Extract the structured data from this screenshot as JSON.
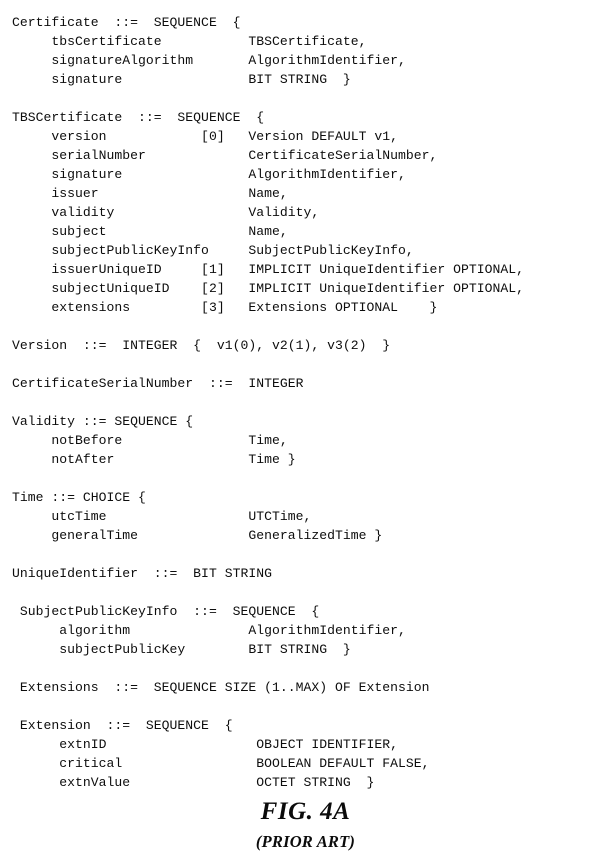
{
  "figure": {
    "number_label": "FIG. 4A",
    "prior_art_label": "(PRIOR ART)"
  },
  "listing": {
    "language": "ASN.1",
    "lines": [
      "Certificate  ::=  SEQUENCE  {",
      "     tbsCertificate           TBSCertificate,",
      "     signatureAlgorithm       AlgorithmIdentifier,",
      "     signature                BIT STRING  }",
      "",
      "TBSCertificate  ::=  SEQUENCE  {",
      "     version            [0]   Version DEFAULT v1,",
      "     serialNumber             CertificateSerialNumber,",
      "     signature                AlgorithmIdentifier,",
      "     issuer                   Name,",
      "     validity                 Validity,",
      "     subject                  Name,",
      "     subjectPublicKeyInfo     SubjectPublicKeyInfo,",
      "     issuerUniqueID     [1]   IMPLICIT UniqueIdentifier OPTIONAL,",
      "     subjectUniqueID    [2]   IMPLICIT UniqueIdentifier OPTIONAL,",
      "     extensions         [3]   Extensions OPTIONAL    }",
      "",
      "Version  ::=  INTEGER  {  v1(0), v2(1), v3(2)  }",
      "",
      "CertificateSerialNumber  ::=  INTEGER",
      "",
      "Validity ::= SEQUENCE {",
      "     notBefore                Time,",
      "     notAfter                 Time }",
      "",
      "Time ::= CHOICE {",
      "     utcTime                  UTCTime,",
      "     generalTime              GeneralizedTime }",
      "",
      "UniqueIdentifier  ::=  BIT STRING",
      "",
      " SubjectPublicKeyInfo  ::=  SEQUENCE  {",
      "      algorithm               AlgorithmIdentifier,",
      "      subjectPublicKey        BIT STRING  }",
      "",
      " Extensions  ::=  SEQUENCE SIZE (1..MAX) OF Extension",
      "",
      " Extension  ::=  SEQUENCE  {",
      "      extnID                   OBJECT IDENTIFIER,",
      "      critical                 BOOLEAN DEFAULT FALSE,",
      "      extnValue                OCTET STRING  }"
    ]
  }
}
